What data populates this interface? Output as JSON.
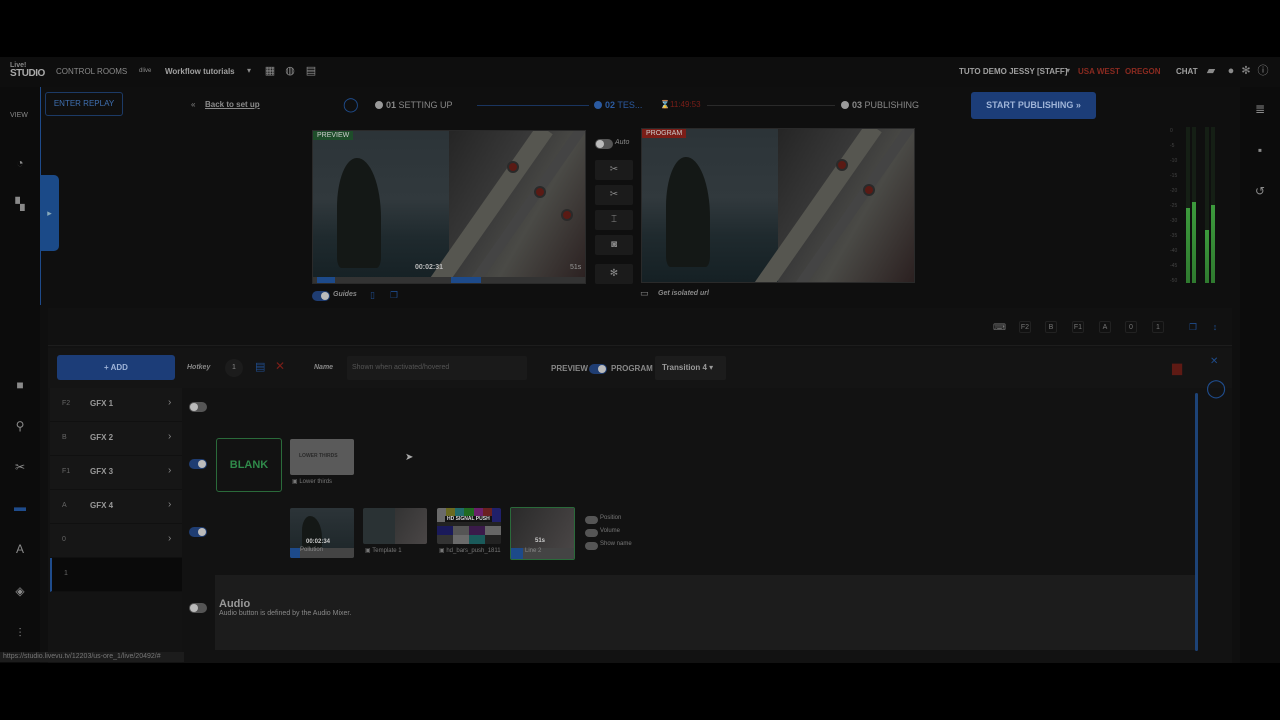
{
  "topbar": {
    "logo_line1": "Live!",
    "logo_line2": "STUDIO",
    "control_rooms": "CONTROL ROOMS",
    "workflow_badge": "dlive",
    "workflow": "Workflow tutorials",
    "user": "TUTO DEMO JESSY [STAFF]",
    "region": "USA WEST",
    "location": "OREGON",
    "chat": "CHAT"
  },
  "left_rail": {
    "view_label": "VIEW"
  },
  "header": {
    "enter_replay": "ENTER REPLAY",
    "back": "Back to set up",
    "step1_num": "01",
    "step1_label": "SETTING UP",
    "step2_num": "02",
    "step2_label": "TES...",
    "step2_timer": "11:49:53",
    "step3_num": "03",
    "step3_label": "PUBLISHING",
    "start_publishing": "START PUBLISHING"
  },
  "preview": {
    "label": "PREVIEW",
    "timecode": "00:02:31",
    "duration": "51s",
    "guides": "Guides"
  },
  "program": {
    "label": "PROGRAM",
    "isolated_url": "Get isolated url"
  },
  "controls": {
    "auto": "Auto"
  },
  "vu_scale": [
    "0",
    "-5",
    "-10",
    "-15",
    "-20",
    "-25",
    "-30",
    "-35",
    "-40",
    "-45",
    "-50"
  ],
  "vu_levels": [
    0.48,
    0.52,
    0.34,
    0.5
  ],
  "shortcuts": [
    "F2",
    "B",
    "F1",
    "A",
    "0",
    "1"
  ],
  "editbar": {
    "add": "+ ADD",
    "hotkey_label": "Hotkey",
    "hotkey_value": "1",
    "name_label": "Name",
    "name_placeholder": "Shown when activated/hovered",
    "preview": "PREVIEW",
    "program": "PROGRAM",
    "transition": "Transition 4"
  },
  "gfx": [
    {
      "key": "F2",
      "name": "GFX 1"
    },
    {
      "key": "B",
      "name": "GFX 2"
    },
    {
      "key": "F1",
      "name": "GFX 3"
    },
    {
      "key": "A",
      "name": "GFX 4"
    },
    {
      "key": "0",
      "name": ""
    },
    {
      "key": "1",
      "name": ""
    }
  ],
  "content": {
    "blank": "BLANK",
    "lower_thirds_title": "LOWER THIRDS",
    "lower_thirds_cap": "Lower thirds",
    "thumb1_time": "00:02:34",
    "thumb1_cap": "Pollution",
    "thumb2_cap": "Template 1",
    "thumb3_cap": "hd_bars_push_1811",
    "thumb3_title": "HD SIGNAL PUSH",
    "thumb4_time": "51s",
    "thumb4_cap": "Line 2",
    "options": [
      "Position",
      "Volume",
      "Show name"
    ],
    "audio_title": "Audio",
    "audio_desc": "Audio button is defined by the Audio Mixer."
  },
  "status_url": "https://studio.livevu.tv/12203/us-ore_1/live/20492/#"
}
